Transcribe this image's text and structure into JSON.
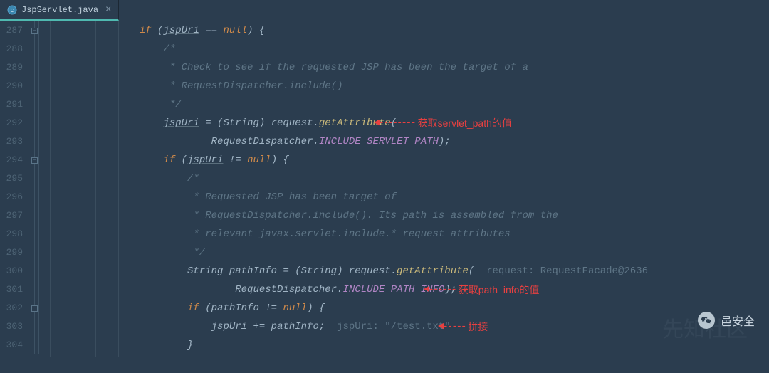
{
  "tab": {
    "label": "JspServlet.java",
    "close": "×"
  },
  "gutter": {
    "start": 287,
    "end": 304
  },
  "code": {
    "l287": {
      "indent": "            ",
      "t1": "if",
      "t2": " (",
      "t3": "jspUri",
      "t4": " == ",
      "t5": "null",
      "t6": ") {"
    },
    "l288": {
      "indent": "                ",
      "t1": "/*"
    },
    "l289": {
      "indent": "                 ",
      "t1": "* Check to see if the requested JSP has been the target of a"
    },
    "l290": {
      "indent": "                 ",
      "t1": "* RequestDispatcher.include()"
    },
    "l291": {
      "indent": "                 ",
      "t1": "*/"
    },
    "l292": {
      "indent": "                ",
      "t1": "jspUri",
      "t2": " = (String) request.",
      "t3": "getAttribute",
      "t4": "("
    },
    "l293": {
      "indent": "                        ",
      "t1": "RequestDispatcher",
      "t2": ".",
      "t3": "INCLUDE_SERVLET_PATH",
      "t4": ");"
    },
    "l294": {
      "indent": "                ",
      "t1": "if",
      "t2": " (",
      "t3": "jspUri",
      "t4": " != ",
      "t5": "null",
      "t6": ") {"
    },
    "l295": {
      "indent": "                    ",
      "t1": "/*"
    },
    "l296": {
      "indent": "                     ",
      "t1": "* Requested JSP has been target of"
    },
    "l297": {
      "indent": "                     ",
      "t1": "* RequestDispatcher.include(). Its path is assembled from the"
    },
    "l298": {
      "indent": "                     ",
      "t1": "* relevant javax.servlet.include.* request attributes"
    },
    "l299": {
      "indent": "                     ",
      "t1": "*/"
    },
    "l300": {
      "indent": "                    ",
      "t1": "String pathInfo = (String) request.",
      "t2": "getAttribute",
      "t3": "(",
      "hint": "  request: RequestFacade@2636"
    },
    "l301": {
      "indent": "                            ",
      "t1": "RequestDispatcher",
      "t2": ".",
      "t3": "INCLUDE_PATH_INFO",
      "t4": ");"
    },
    "l302": {
      "indent": "                    ",
      "t1": "if",
      "t2": " (pathInfo != ",
      "t3": "null",
      "t4": ") {"
    },
    "l303": {
      "indent": "                        ",
      "t1": "jspUri",
      "t2": " += pathInfo;",
      "hint": "  jspUri: \"/test.txt\""
    },
    "l304": {
      "indent": "                    ",
      "t1": "}"
    }
  },
  "annotations": {
    "a1": {
      "arrow": "◄--------",
      "text": "获取servlet_path的值"
    },
    "a2": {
      "arrow": "◄------",
      "text": "获取path_info的值"
    },
    "a3": {
      "arrow": "◄-----",
      "text": "拼接"
    }
  },
  "watermark": {
    "bg": "先知社区",
    "text": "邑安全"
  }
}
